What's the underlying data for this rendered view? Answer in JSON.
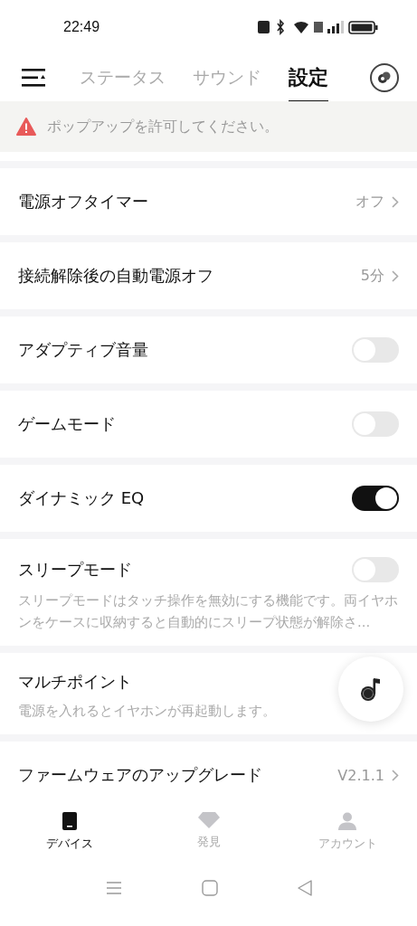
{
  "status_bar": {
    "time": "22:49"
  },
  "tabs": [
    {
      "label": "ステータス",
      "selected": false
    },
    {
      "label": "サウンド",
      "selected": false
    },
    {
      "label": "設定",
      "selected": true
    }
  ],
  "alert": {
    "text": "ポップアップを許可してください。"
  },
  "settings": [
    {
      "kind": "link",
      "label": "電源オフタイマー",
      "value": "オフ"
    },
    {
      "kind": "link",
      "label": "接続解除後の自動電源オフ",
      "value": "5分"
    },
    {
      "kind": "toggle",
      "label": "アダプティブ音量",
      "on": false
    },
    {
      "kind": "toggle",
      "label": "ゲームモード",
      "on": false
    },
    {
      "kind": "toggle",
      "label": "ダイナミック EQ",
      "on": true
    },
    {
      "kind": "toggle",
      "label": "スリープモード",
      "on": false,
      "description": "スリープモードはタッチ操作を無効にする機能です。両イヤホンをケースに収納すると自動的にスリープ状態が解除さ..."
    },
    {
      "kind": "info",
      "label": "マルチポイント",
      "description": "電源を入れるとイヤホンが再起動します。"
    },
    {
      "kind": "link",
      "label": "ファームウェアのアップグレード",
      "value": "V2.1.1"
    }
  ],
  "bottom_nav": [
    {
      "label": "デバイス",
      "selected": true
    },
    {
      "label": "発見",
      "selected": false
    },
    {
      "label": "アカウント",
      "selected": false
    }
  ]
}
